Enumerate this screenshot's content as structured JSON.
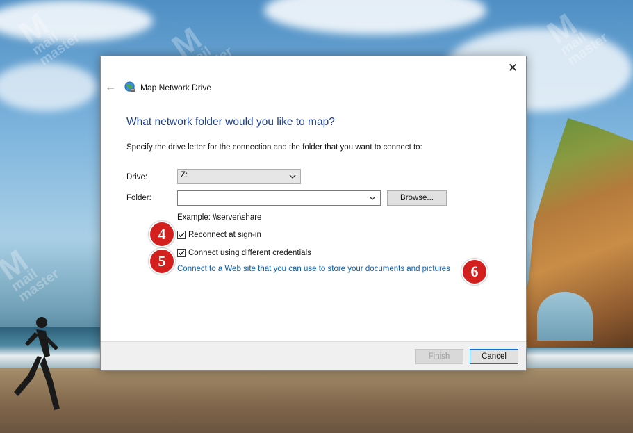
{
  "dialog": {
    "title": "Map Network Drive",
    "close_glyph": "✕",
    "back_glyph": "←",
    "heading": "What network folder would you like to map?",
    "description": "Specify the drive letter for the connection and the folder that you want to connect to:",
    "drive_label": "Drive:",
    "drive_value": "Z:",
    "folder_label": "Folder:",
    "folder_value": "",
    "browse_label": "Browse...",
    "example_text": "Example: \\\\server\\share",
    "reconnect_label": "Reconnect at sign-in",
    "reconnect_checked": true,
    "credentials_label": "Connect using different credentials",
    "credentials_checked": true,
    "web_link_text": "Connect to a Web site that you can use to store your documents and pictures",
    "finish_label": "Finish",
    "cancel_label": "Cancel"
  },
  "annotations": {
    "marker_4": "4",
    "marker_5": "5",
    "marker_6": "6",
    "marker_color": "#d41f1f"
  },
  "watermark": {
    "logo_letter": "M",
    "line1": "mail",
    "line2": "master"
  },
  "colors": {
    "heading": "#1c3d92",
    "link": "#0a5fb4",
    "accent_border": "#0078d7"
  }
}
